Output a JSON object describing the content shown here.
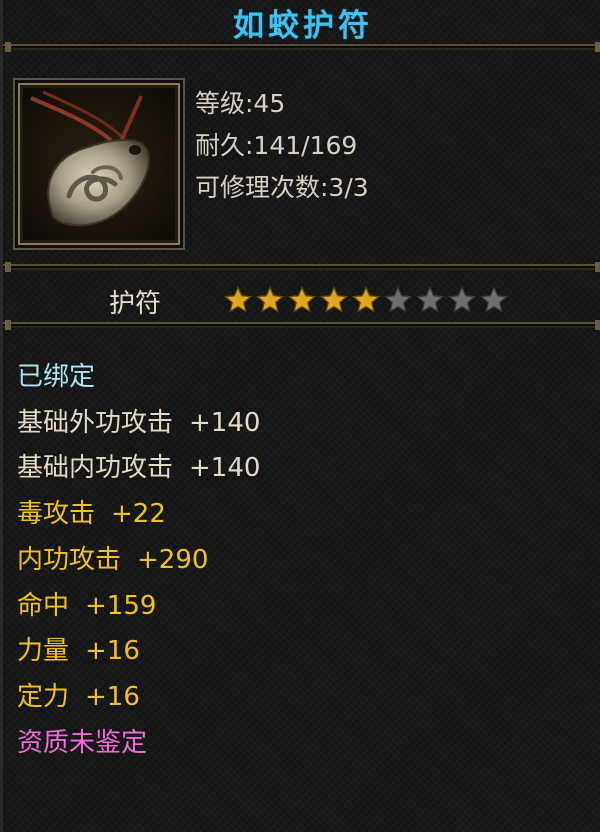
{
  "item": {
    "name": "如蛟护符",
    "level_line": "等级:45",
    "durability_line": "耐久:141/169",
    "repair_line": "可修理次数:3/3",
    "type": "护符",
    "stars_filled": 5,
    "stars_total": 9
  },
  "attributes": [
    {
      "label": "已绑定",
      "value": "",
      "color": "#a9e6f0"
    },
    {
      "label": "基础外功攻击",
      "value": "+140",
      "color": "#e4d9c4"
    },
    {
      "label": "基础内功攻击",
      "value": "+140",
      "color": "#e4d9c4"
    },
    {
      "label": "毒攻击",
      "value": "+22",
      "color": "#f2c21b"
    },
    {
      "label": "内功攻击",
      "value": "+290",
      "color": "#f2c21b"
    },
    {
      "label": "命中",
      "value": "+159",
      "color": "#f2c21b"
    },
    {
      "label": "力量",
      "value": "+16",
      "color": "#f2c21b"
    },
    {
      "label": "定力",
      "value": "+16",
      "color": "#f2c21b"
    },
    {
      "label": "资质未鉴定",
      "value": "",
      "color": "#f06ad8"
    }
  ],
  "colors": {
    "title": "#3fc3ee",
    "star_filled": "#e0a81e",
    "star_empty": "#6e6e6e"
  },
  "icons": {
    "item_icon": "jade-amulet-icon",
    "star_icon": "star-icon"
  }
}
